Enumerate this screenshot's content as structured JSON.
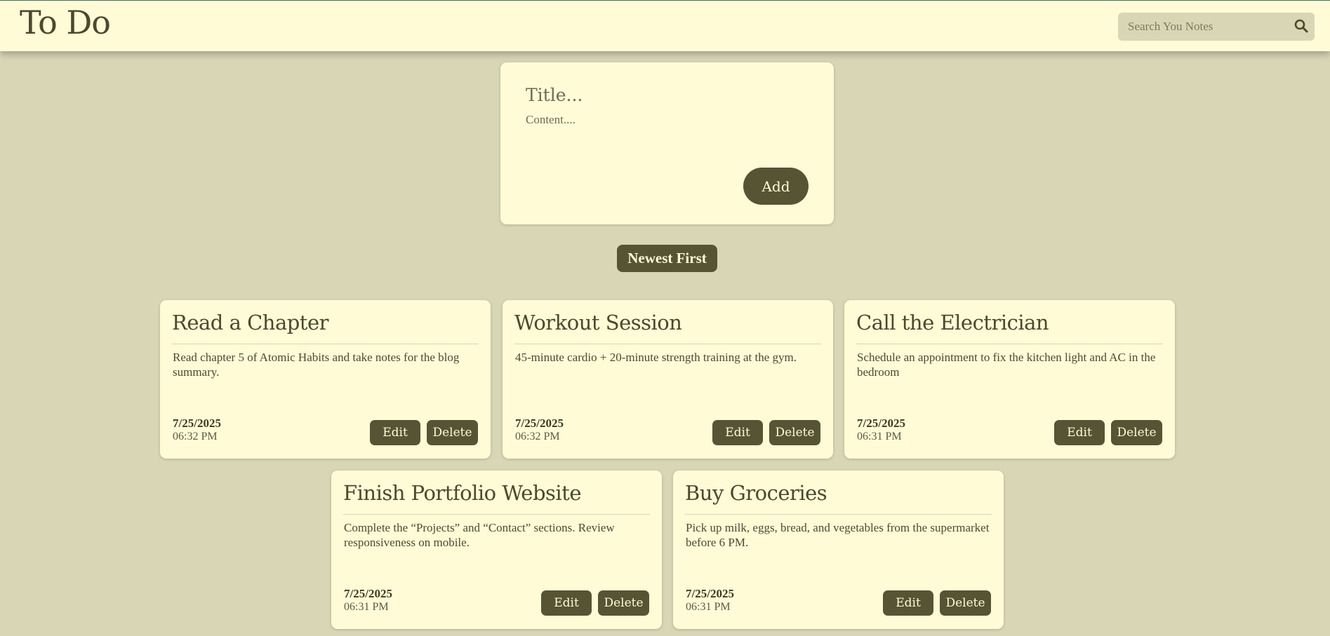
{
  "header": {
    "title": "To Do",
    "search_placeholder": "Search You Notes",
    "search_icon": "magnifier"
  },
  "composer": {
    "title_placeholder": "Title...",
    "content_placeholder": "Content....",
    "add_label": "Add"
  },
  "sort": {
    "label": "Newest First"
  },
  "notes": [
    {
      "title": "Read a Chapter",
      "content": "Read chapter 5 of Atomic Habits and take notes for the blog summary.",
      "date": "7/25/2025",
      "time": "06:32 PM",
      "edit_label": "Edit",
      "delete_label": "Delete"
    },
    {
      "title": "Workout Session",
      "content": "45-minute cardio + 20-minute strength training at the gym.",
      "date": "7/25/2025",
      "time": "06:32 PM",
      "edit_label": "Edit",
      "delete_label": "Delete"
    },
    {
      "title": "Call the Electrician",
      "content": "Schedule an appointment to fix the kitchen light and AC in the bedroom",
      "date": "7/25/2025",
      "time": "06:31 PM",
      "edit_label": "Edit",
      "delete_label": "Delete"
    },
    {
      "title": "Finish Portfolio Website",
      "content": "Complete the “Projects” and “Contact” sections. Review responsiveness on mobile.",
      "date": "7/25/2025",
      "time": "06:31 PM",
      "edit_label": "Edit",
      "delete_label": "Delete"
    },
    {
      "title": "Buy Groceries",
      "content": "Pick up milk, eggs, bread, and vegetables from the supermarket before 6 PM.",
      "date": "7/25/2025",
      "time": "06:31 PM",
      "edit_label": "Edit",
      "delete_label": "Delete"
    }
  ],
  "colors": {
    "background": "#d9d6b6",
    "card": "#fffbd7",
    "accent": "#575435",
    "text": "#4d4a30"
  }
}
